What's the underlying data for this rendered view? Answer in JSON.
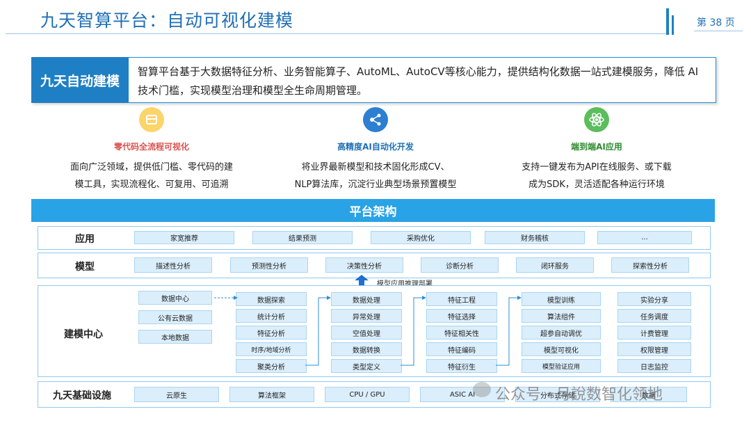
{
  "header": {
    "title": "九天智算平台：自动可视化建模",
    "page": "第 38 页"
  },
  "intro": {
    "label": "九天自动建模",
    "text": "智算平台基于大数据特征分析、业务智能算子、AutoML、AutoCV等核心能力，提供结构化数据一站式建模服务，降低 AI 技术门槛，实现模型治理和模型全生命周期管理。"
  },
  "features": [
    {
      "title": "零代码全流程可视化",
      "line1": "面向广泛领域，提供低门槛、零代码的建",
      "line2": "模工具，实现流程化、可复用、可追溯",
      "icon": "box-icon",
      "color": "#f5a623"
    },
    {
      "title": "高精度AI自动化开发",
      "line1": "将业界最新模型和技术固化形成CV、",
      "line2": "NLP算法库，沉淀行业典型场景预置模型",
      "icon": "network-icon",
      "color": "#2c7fd1"
    },
    {
      "title": "端到端AI应用",
      "line1": "支持一键发布为API在线服务、或下载",
      "line2": "成为SDK，灵活适配各种运行环境",
      "icon": "atom-icon",
      "color": "#4cb04c"
    }
  ],
  "arch": {
    "title": "平台架构",
    "app": {
      "label": "应用",
      "items": [
        "家宽推荐",
        "结果预测",
        "采购优化",
        "财务稽核",
        "..."
      ]
    },
    "model": {
      "label": "模型",
      "items": [
        "描述性分析",
        "预测性分析",
        "决策性分析",
        "诊断分析",
        "闭环服务",
        "探索性分析"
      ]
    },
    "deploy_note": "模型应用推理部署",
    "center": {
      "label": "建模中心",
      "sources": [
        "数据中心",
        "公有云数据",
        "本地数据"
      ],
      "explore": [
        "数据探索",
        "统计分析",
        "特征分析",
        "时序/地域分析",
        "聚类分析"
      ],
      "process": [
        "数据处理",
        "异常处理",
        "空值处理",
        "数据转换",
        "类型定义"
      ],
      "feature": [
        "特征工程",
        "特征选择",
        "特征相关性",
        "特征编码",
        "特征衍生"
      ],
      "train": [
        "模型训练",
        "算法组件",
        "超参自动调优",
        "模型可视化",
        "模型验证应用"
      ],
      "ops": [
        "实验分享",
        "任务调度",
        "计费管理",
        "权限管理",
        "日志监控"
      ]
    },
    "infra": {
      "label": "九天基础设施",
      "items": [
        "云原生",
        "算法框架",
        "CPU / GPU",
        "ASIC AI",
        "分布式存储",
        "数据"
      ]
    }
  },
  "watermark": "公众号 · 月說数智化领地"
}
